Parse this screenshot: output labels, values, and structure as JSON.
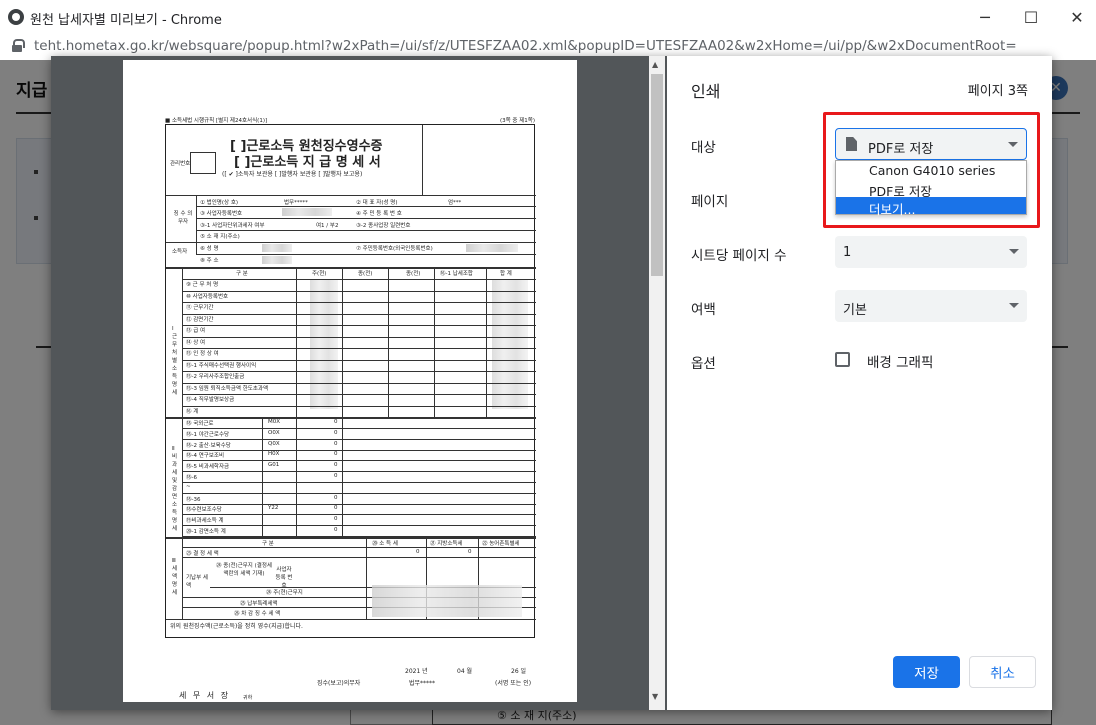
{
  "window": {
    "title": "원천 납세자별 미리보기 - Chrome",
    "minimize": "─",
    "maximize": "☐",
    "close": "✕"
  },
  "address_bar": {
    "url": "teht.hometax.go.kr/websquare/popup.html?w2xPath=/ui/sf/z/UTESFZAA02.xml&popupID=UTESFZAA02&w2xHome=/ui/pp/&w2xDocumentRoot="
  },
  "background_page": {
    "title": "지급",
    "close": "✕",
    "address_cell": "⑤ 소 재 지(주소)"
  },
  "print_dialog": {
    "title": "인쇄",
    "page_count": "페이지 3쪽",
    "destination": {
      "label": "대상",
      "selected": "PDF로 저장",
      "options": [
        "Canon G4010 series",
        "PDF로 저장",
        "더보기..."
      ],
      "highlighted_index": 2
    },
    "pages": {
      "label": "페이지"
    },
    "pages_per_sheet": {
      "label": "시트당 페이지 수",
      "value": "1"
    },
    "margins": {
      "label": "여백",
      "value": "기본"
    },
    "options": {
      "label": "옵션",
      "background_graphics": "배경 그래픽",
      "background_graphics_checked": false
    },
    "save_button": "저장",
    "cancel_button": "취소"
  },
  "preview_document": {
    "form_number": "■ 소득세법 시행규칙 [별지 제24호서식(1)]",
    "page_indicator": "(3쪽 중 제1쪽)",
    "title_line1": "[ ]근로소득 원천징수영수증",
    "title_line2": "[ ]근로소득 지 급 명 세 서",
    "subtitle": "([ ✔ ]소득자 보관용 [ ]발행자 보관용 [ ]발행자 보고용)",
    "mgmt_no": "관리번호",
    "withholder": "징 수 의무자",
    "income_earner": "소득자",
    "company_label": "① 법인명(상 호)",
    "company_value": "법무*****",
    "rep_label": "② 대 표 자(성 명)",
    "rep_value": "엄***",
    "bizno_label": "③ 사업자등록번호",
    "resno_label": "④ 주 민 등 록 번 호",
    "unit_label": "③-1 사업자단위과세자 여부",
    "unit_value": "여1 / 부2",
    "sub_biz_label": "③-2 종사업장 일련번호",
    "address_label": "⑤ 소 재 지(주소)",
    "name_label": "⑥ 성 명",
    "resident_label": "⑦ 주민등록번호(외국인등록번호)",
    "addr2_label": "⑧ 주 소",
    "section_work": "Ⅰ 근무처별소득명세",
    "section_nontax": "Ⅱ 비과세 및 감면 소득 명세",
    "section_tax": "Ⅲ 세액명세",
    "col_div": "구 분",
    "col_main": "주(현)",
    "col_sub1": "종(전)",
    "col_sub2": "종(전)",
    "col_tax_assoc": "⑯-1 납세조합",
    "col_total": "합 계",
    "rows_work": [
      "⑨ 근 무 처 명",
      "⑩ 사업자등록번호",
      "⑪ 근무기간",
      "⑫ 감면기간",
      "⑬ 급 여",
      "⑭ 상 여",
      "⑮ 인 정 상 여",
      "⑮-1 주식매수선택권 행사이익",
      "⑮-2 우리사주조합인출금",
      "⑮-3 임원 퇴직소득금액 한도초과액",
      "⑮-4 직무발명보상금",
      "⑯ 계"
    ],
    "rows_nontax": [
      {
        "label": "⑱ 국외근로",
        "code": "M0X",
        "value": "0"
      },
      {
        "label": "⑱-1 야간근로수당",
        "code": "O0X",
        "value": "0"
      },
      {
        "label": "⑱-2 출산·보육수당",
        "code": "Q0X",
        "value": "0"
      },
      {
        "label": "⑱-4 연구보조비",
        "code": "H0X",
        "value": "0"
      },
      {
        "label": "⑱-5 비과세학자금",
        "code": "G01",
        "value": "0"
      },
      {
        "label": "⑱-6",
        "code": "",
        "value": "0"
      },
      {
        "label": "~",
        "code": "",
        "value": ""
      },
      {
        "label": "⑱-36",
        "code": "",
        "value": "0"
      },
      {
        "label": "⑱수련보조수당",
        "code": "Y22",
        "value": "0"
      },
      {
        "label": "⑲비과세소득 계",
        "code": "",
        "value": "0"
      },
      {
        "label": "⑳-1 감면소득 계",
        "code": "",
        "value": "0"
      }
    ],
    "tax_cols": [
      "⑳ 소 득 세",
      "㉑ 지방소득세",
      "㉒ 농어촌특별세"
    ],
    "tax_rows": [
      "㉓ 결 정 세 액",
      "기납부 세 액",
      "㉔ 주(현)근무지",
      "㉕ 납부특례세액",
      "㉖ 차 감 징 수 세 액"
    ],
    "prev_work": "㉔ 종(전)근무지 (결정세액란의 세액 기재)",
    "prev_bizno": "사업자 등록 번호",
    "zero": "0",
    "confirm_text": "위의 원천징수액(근로소득)을 정히 영수(지급)합니다.",
    "date_year": "2021 년",
    "date_month": "04 월",
    "date_day": "26 일",
    "payer_label": "징수(보고)의무자",
    "payer_value": "법무*****",
    "seal": "(서명 또는 인)",
    "tax_office": "세 무 서 장",
    "honorific": "귀하"
  }
}
